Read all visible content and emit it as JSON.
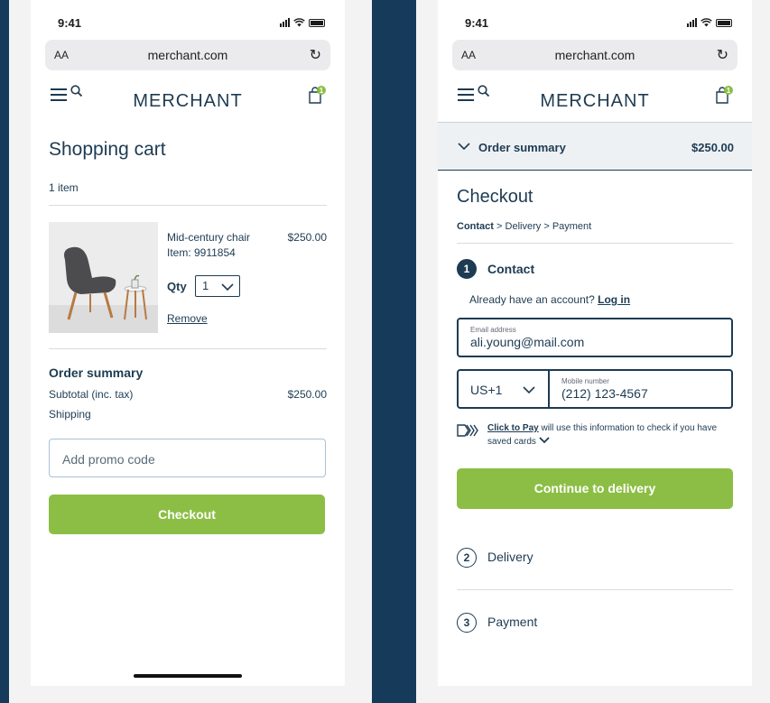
{
  "left": {
    "status": {
      "time": "9:41"
    },
    "browser": {
      "aa": "AA",
      "url": "merchant.com",
      "reload": "↻"
    },
    "nav": {
      "brand": "MERCHANT",
      "cart_badge": "1"
    },
    "cart": {
      "title": "Shopping cart",
      "count": "1 item",
      "item": {
        "name": "Mid-century chair",
        "sku": "Item: 9911854",
        "price": "$250.00",
        "qty_label": "Qty",
        "qty_value": "1",
        "remove": "Remove"
      }
    },
    "summary": {
      "title": "Order summary",
      "subtotal_label": "Subtotal (inc. tax)",
      "subtotal_value": "$250.00",
      "shipping_label": "Shipping"
    },
    "promo": {
      "placeholder": "Add promo code"
    },
    "checkout_button": "Checkout"
  },
  "right": {
    "status": {
      "time": "9:41"
    },
    "browser": {
      "aa": "AA",
      "url": "merchant.com",
      "reload": "↻"
    },
    "nav": {
      "brand": "MERCHANT",
      "cart_badge": "1"
    },
    "order_summary": {
      "label": "Order summary",
      "total": "$250.00"
    },
    "checkout": {
      "title": "Checkout",
      "crumb_contact": "Contact",
      "crumb_delivery": "Delivery",
      "crumb_payment": "Payment",
      "sep": ">"
    },
    "steps": [
      {
        "num": "1",
        "label": "Contact"
      },
      {
        "num": "2",
        "label": "Delivery"
      },
      {
        "num": "3",
        "label": "Payment"
      }
    ],
    "contact": {
      "account_prompt": "Already have an account?",
      "login": "Log in",
      "email_label": "Email address",
      "email_value": "ali.young@mail.com",
      "country_code": "US+1",
      "mobile_label": "Mobile number",
      "mobile_value": "(212) 123-4567",
      "ctp_link": "Click to Pay",
      "ctp_text": "will use this information to check if you have saved cards"
    },
    "continue_button": "Continue to delivery"
  },
  "colors": {
    "navy": "#1d3b52",
    "green": "#8cbe45",
    "background": "#163a5a",
    "badge": "#8cbe45"
  },
  "icons": [
    "menu-icon",
    "search-icon",
    "bag-icon",
    "reload-icon",
    "chevron-down-icon",
    "click-to-pay-icon",
    "signal-icon",
    "wifi-icon",
    "battery-icon"
  ]
}
